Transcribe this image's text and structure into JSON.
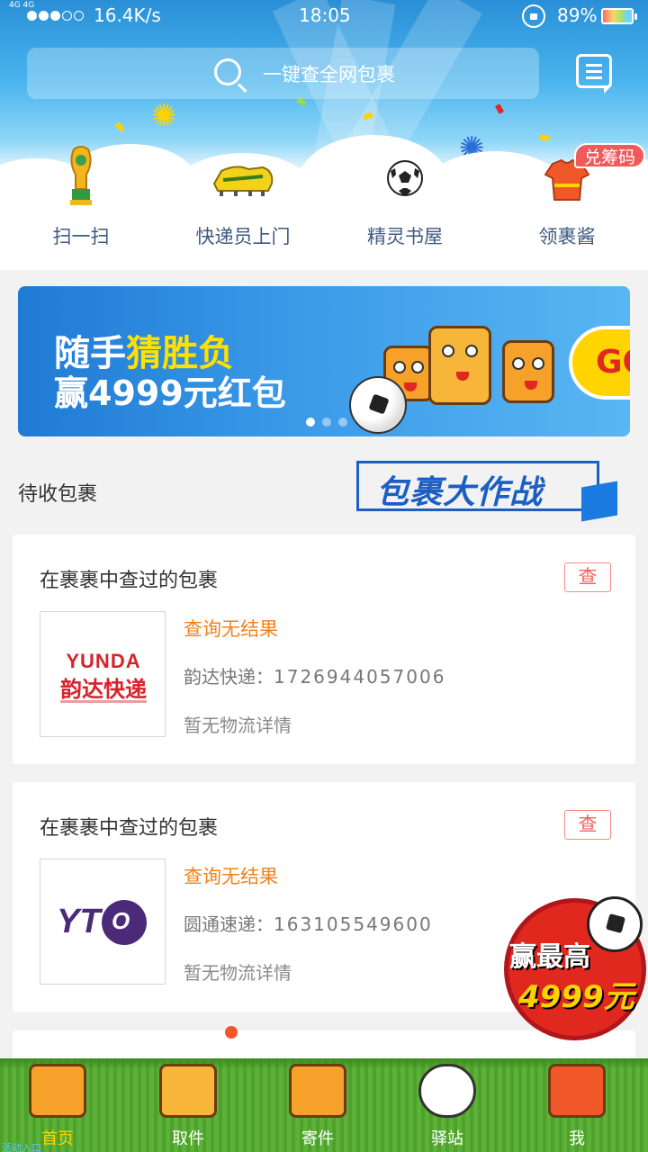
{
  "status_bar": {
    "network": "4G 4G",
    "speed": "16.4K/s",
    "time": "18:05",
    "battery": "89%"
  },
  "search": {
    "placeholder": "一键查全网包裹"
  },
  "quick_entries": [
    {
      "label": "扫一扫",
      "icon": "trophy-icon"
    },
    {
      "label": "快递员上门",
      "icon": "football-boot-icon"
    },
    {
      "label": "精灵书屋",
      "icon": "soccer-ball-icon"
    },
    {
      "label": "领裹酱",
      "icon": "jersey-icon"
    }
  ],
  "exchange_badge": "兑筹码",
  "banner": {
    "line1_prefix": "随手",
    "line1_highlight": "猜胜负",
    "line2": "赢4999元红包",
    "go_label": "GO"
  },
  "section": {
    "title": "待收包裹",
    "logo_text": "包裹大作战"
  },
  "packages": [
    {
      "title": "在裹裹中查过的包裹",
      "check_label": "查",
      "status": "查询无结果",
      "courier": "韵达快递：",
      "tracking": "1726944057006",
      "detail": "暂无物流详情",
      "logo_en": "YUNDA",
      "logo_cn": "韵达快递"
    },
    {
      "title": "在裹裹中查过的包裹",
      "check_label": "查",
      "status": "查询无结果",
      "courier": "圆通速递：",
      "tracking": "163105549600",
      "detail": "暂无物流详情",
      "logo_en": "YT",
      "logo_cn": "O"
    }
  ],
  "float_promo": {
    "line1": "赢最高",
    "line2": "4999元"
  },
  "tabs": [
    {
      "label": "首页",
      "active": true
    },
    {
      "label": "取件",
      "active": false
    },
    {
      "label": "寄件",
      "active": false
    },
    {
      "label": "驿站",
      "active": false
    },
    {
      "label": "我",
      "active": false
    }
  ],
  "bottom_link": "活动入口",
  "colors": {
    "accent": "#f0821e",
    "check": "#f0645a",
    "tab_active": "#ffd200",
    "banner_blue": "#1f7ad4"
  }
}
